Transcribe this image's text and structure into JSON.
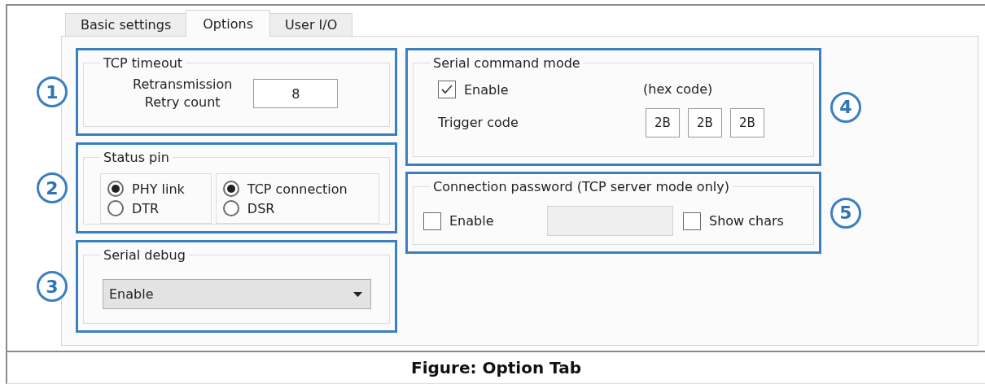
{
  "tabs": [
    {
      "label": "Basic settings",
      "selected": false
    },
    {
      "label": "Options",
      "selected": true
    },
    {
      "label": "User I/O",
      "selected": false
    }
  ],
  "tcp_timeout": {
    "callout": "1",
    "title": "TCP timeout",
    "label": "Retransmission\nRetry count",
    "value": "8"
  },
  "status_pin": {
    "callout": "2",
    "title": "Status pin",
    "options": [
      [
        {
          "label": "PHY link",
          "selected": true
        },
        {
          "label": "DTR",
          "selected": false
        }
      ],
      [
        {
          "label": "TCP connection",
          "selected": true
        },
        {
          "label": "DSR",
          "selected": false
        }
      ]
    ]
  },
  "serial_debug": {
    "callout": "3",
    "title": "Serial debug",
    "value": "Enable"
  },
  "serial_command_mode": {
    "callout": "4",
    "title": "Serial command mode",
    "enable": {
      "label": "Enable",
      "checked": true
    },
    "hint": "(hex code)",
    "trigger_label": "Trigger code",
    "trigger_codes": [
      "2B",
      "2B",
      "2B"
    ]
  },
  "connection_password": {
    "callout": "5",
    "title": "Connection password (TCP server mode only)",
    "enable": {
      "label": "Enable",
      "checked": false
    },
    "password": {
      "disabled": true
    },
    "show_chars": {
      "label": "Show chars",
      "checked": false
    }
  },
  "caption": "Figure: Option Tab"
}
